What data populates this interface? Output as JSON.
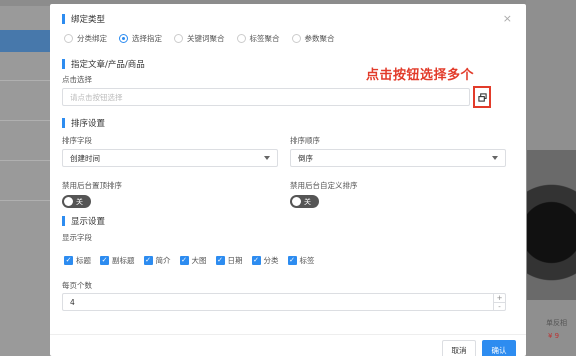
{
  "background": {
    "right_text": "单反相",
    "right_price": "¥ 9"
  },
  "modal": {
    "close_symbol": "×",
    "bind_type": {
      "title": "绑定类型",
      "options": [
        "分类绑定",
        "选择指定",
        "关键词聚合",
        "标签聚合",
        "参数聚合"
      ],
      "selected": "选择指定"
    },
    "specify": {
      "title": "指定文章/产品/商品",
      "field_label": "点击选择",
      "placeholder": "请点击按钮选择",
      "annotation": "点击按钮选择多个"
    },
    "sort": {
      "title": "排序设置",
      "field_label": "排序字段",
      "field_value": "创建时间",
      "order_label": "排序顺序",
      "order_value": "倒序",
      "disable_top_label": "禁用后台置顶排序",
      "disable_top_state": "关",
      "disable_custom_label": "禁用后台自定义排序",
      "disable_custom_state": "关"
    },
    "display": {
      "title": "显示设置",
      "fields_label": "显示字段",
      "fields": [
        "标题",
        "副标题",
        "简介",
        "大图",
        "日期",
        "分类",
        "标签"
      ],
      "per_page_label": "每页个数",
      "per_page_value": "4"
    },
    "footer": {
      "cancel": "取消",
      "confirm": "确认"
    }
  }
}
